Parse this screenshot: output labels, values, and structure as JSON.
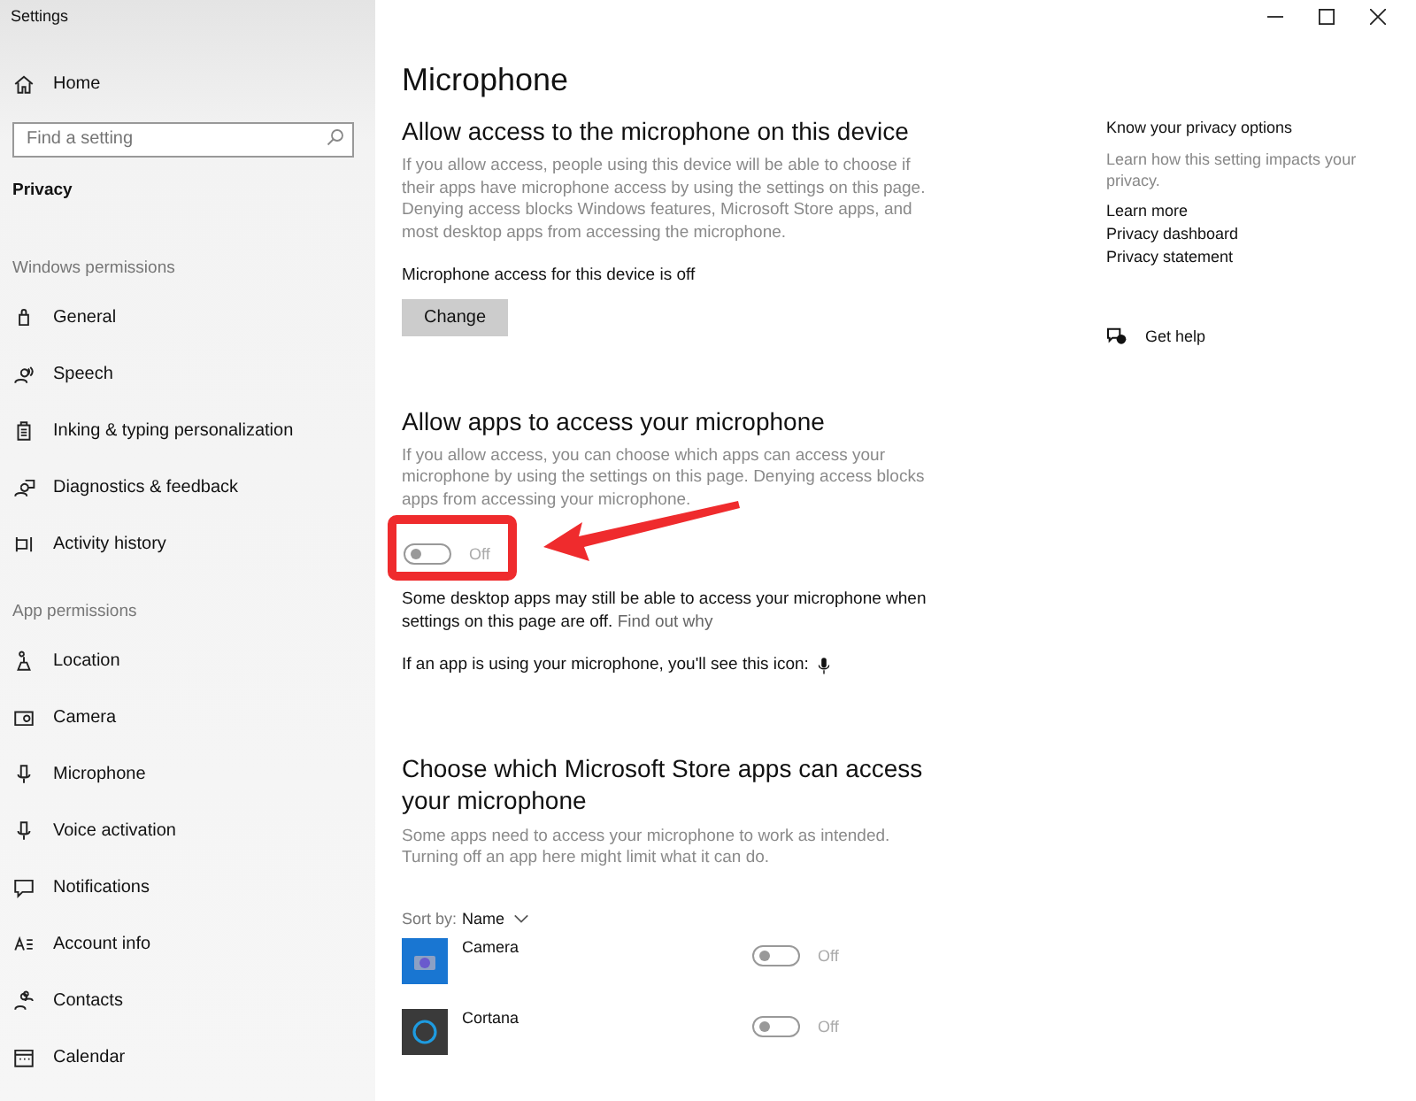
{
  "window": {
    "title": "Settings"
  },
  "sidebar": {
    "home": "Home",
    "search": {
      "placeholder": "Find a setting"
    },
    "section": "Privacy",
    "groups": [
      {
        "heading": "Windows permissions",
        "items": [
          {
            "label": "General"
          },
          {
            "label": "Speech"
          },
          {
            "label": "Inking & typing personalization"
          },
          {
            "label": "Diagnostics & feedback"
          },
          {
            "label": "Activity history"
          }
        ]
      },
      {
        "heading": "App permissions",
        "items": [
          {
            "label": "Location"
          },
          {
            "label": "Camera"
          },
          {
            "label": "Microphone"
          },
          {
            "label": "Voice activation"
          },
          {
            "label": "Notifications"
          },
          {
            "label": "Account info"
          },
          {
            "label": "Contacts"
          },
          {
            "label": "Calendar"
          }
        ]
      }
    ]
  },
  "page": {
    "title": "Microphone",
    "device": {
      "heading": "Allow access to the microphone on this device",
      "description": "If you allow access, people using this device will be able to choose if their apps have microphone access by using the settings on this page. Denying access blocks Windows features, Microsoft Store apps, and most desktop apps from accessing the microphone.",
      "status": "Microphone access for this device is off",
      "button": "Change"
    },
    "apps": {
      "heading": "Allow apps to access your microphone",
      "description": "If you allow access, you can choose which apps can access your microphone by using the settings on this page. Denying access blocks apps from accessing your microphone.",
      "toggle": {
        "on": false,
        "label": "Off"
      },
      "note": "Some desktop apps may still be able to access your microphone when settings on this page are off.",
      "note_link": "Find out why",
      "icon_note": "If an app is using your microphone, you'll see this icon:"
    },
    "store": {
      "heading": "Choose which Microsoft Store apps can access your microphone",
      "description": "Some apps need to access your microphone to work as intended. Turning off an app here might limit what it can do.",
      "sort_label": "Sort by:",
      "sort_value": "Name",
      "apps": [
        {
          "name": "Camera",
          "on": false,
          "label": "Off"
        },
        {
          "name": "Cortana",
          "on": false,
          "label": "Off"
        }
      ]
    }
  },
  "aside": {
    "heading": "Know your privacy options",
    "text": "Learn how this setting impacts your privacy.",
    "links": [
      "Learn more",
      "Privacy dashboard",
      "Privacy statement"
    ],
    "help": "Get help"
  }
}
